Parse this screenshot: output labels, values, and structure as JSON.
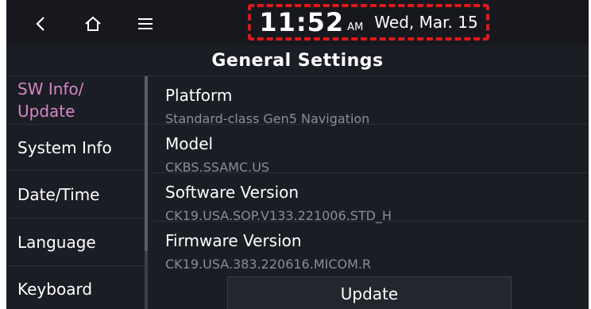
{
  "topbar": {
    "icons": [
      "back-icon",
      "home-icon",
      "menu-icon"
    ],
    "time": "11:52",
    "ampm": "AM",
    "date": "Wed, Mar. 15",
    "highlight_color": "#e11818"
  },
  "title": "General Settings",
  "sidebar": {
    "items": [
      {
        "line1": "SW Info/",
        "line2": "Update",
        "active": true
      },
      {
        "label": "System Info"
      },
      {
        "label": "Date/Time"
      },
      {
        "label": "Language"
      },
      {
        "label": "Keyboard"
      }
    ],
    "active_color": "#d686c4"
  },
  "content": {
    "rows": [
      {
        "label": "Platform",
        "value": "Standard-class Gen5 Navigation"
      },
      {
        "label": "Model",
        "value": "CKBS.SSAMC.US"
      },
      {
        "label": "Software Version",
        "value": "CK19.USA.SOP.V133.221006.STD_H"
      },
      {
        "label": "Firmware Version",
        "value": "CK19.USA.383.220616.MICOM.R"
      }
    ],
    "update_label": "Update"
  }
}
